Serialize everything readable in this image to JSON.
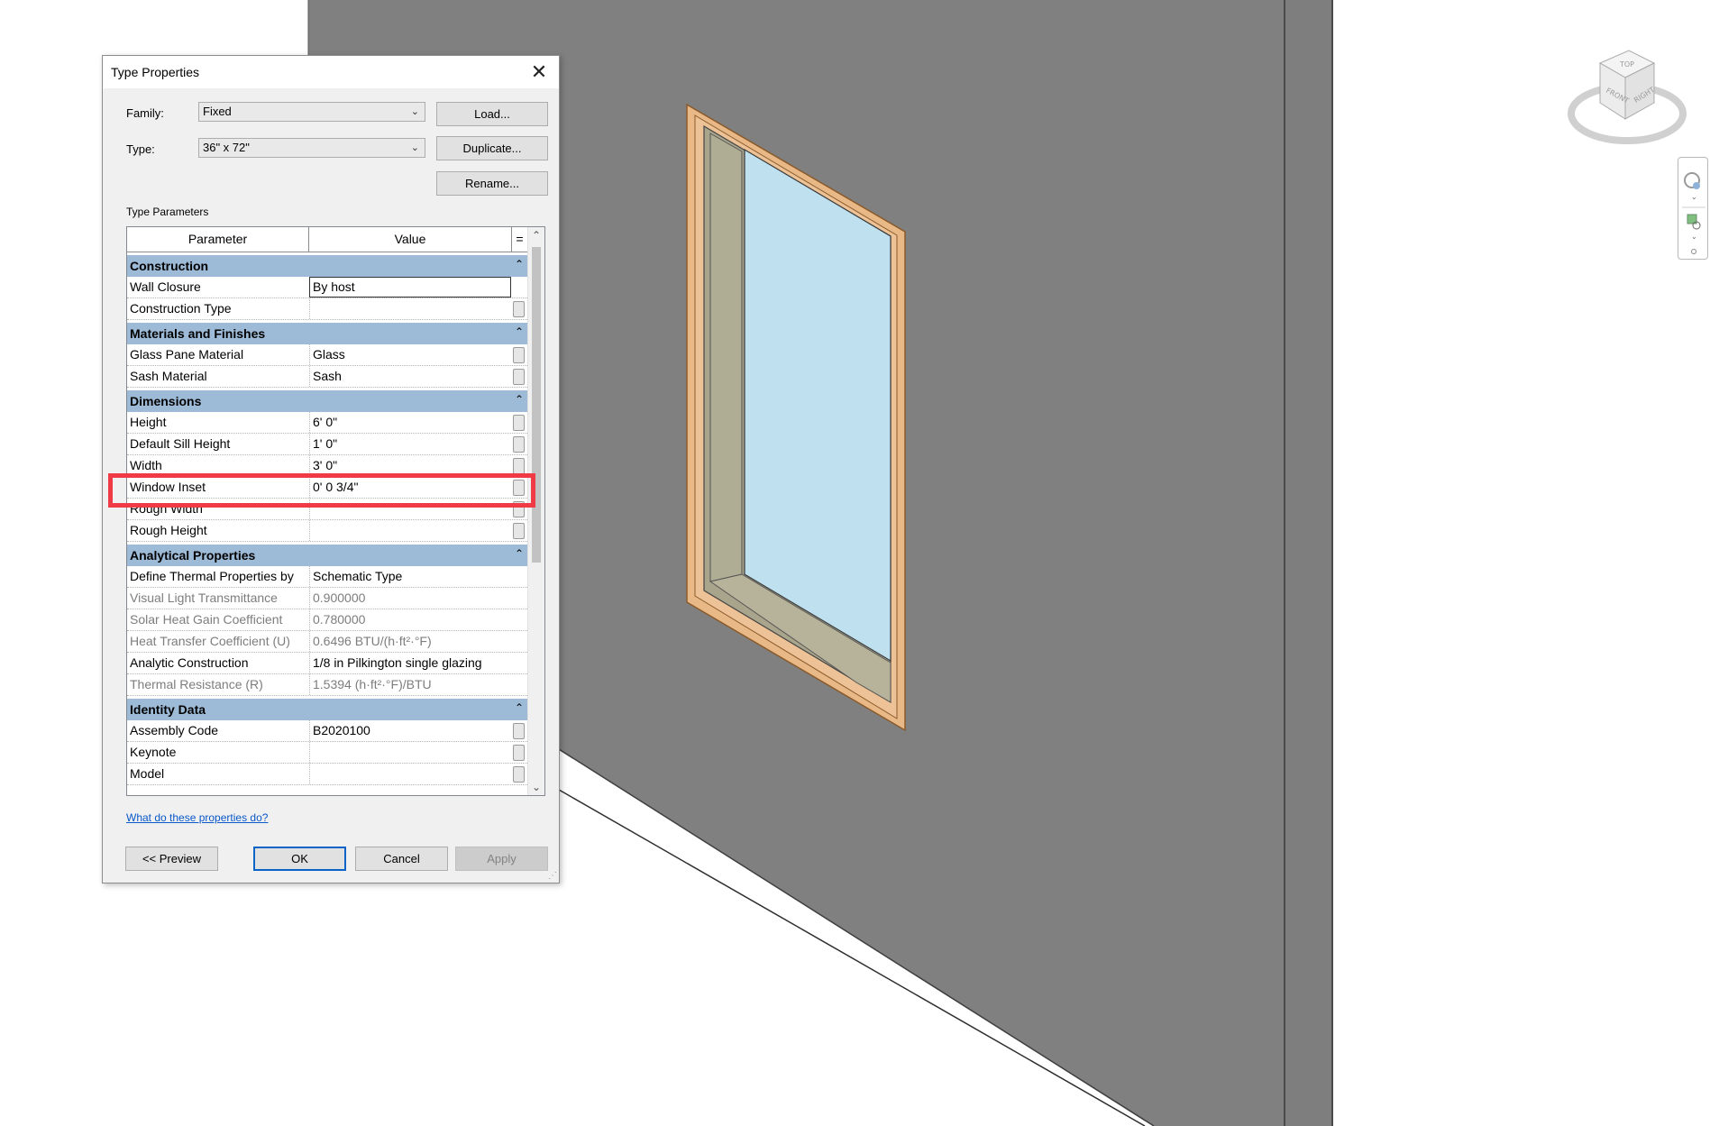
{
  "dialog": {
    "title": "Type Properties",
    "family_label": "Family:",
    "family_value": "Fixed",
    "type_label": "Type:",
    "type_value": "36\" x 72\"",
    "load_label": "Load...",
    "duplicate_label": "Duplicate...",
    "rename_label": "Rename...",
    "type_parameters_label": "Type Parameters",
    "col_parameter": "Parameter",
    "col_value": "Value",
    "col_eq": "=",
    "help_link": "What do these properties do?",
    "preview_label": "<< Preview",
    "ok_label": "OK",
    "cancel_label": "Cancel",
    "apply_label": "Apply"
  },
  "groups": [
    {
      "name": "Construction",
      "rows": [
        {
          "param": "Wall Closure",
          "value": "By host",
          "editing": true,
          "square": false
        },
        {
          "param": "Construction Type",
          "value": "",
          "square": true
        }
      ]
    },
    {
      "name": "Materials and Finishes",
      "rows": [
        {
          "param": "Glass Pane Material",
          "value": "Glass",
          "square": true
        },
        {
          "param": "Sash Material",
          "value": "Sash",
          "square": true
        }
      ]
    },
    {
      "name": "Dimensions",
      "rows": [
        {
          "param": "Height",
          "value": "6'  0\"",
          "square": true
        },
        {
          "param": "Default Sill Height",
          "value": "1'  0\"",
          "square": true
        },
        {
          "param": "Width",
          "value": "3'  0\"",
          "square": true
        },
        {
          "param": "Window Inset",
          "value": "0'  0 3/4\"",
          "square": true
        },
        {
          "param": "Rough Width",
          "value": "",
          "square": true
        },
        {
          "param": "Rough Height",
          "value": "",
          "square": true
        }
      ]
    },
    {
      "name": "Analytical Properties",
      "rows": [
        {
          "param": "Define Thermal Properties by",
          "value": "Schematic Type",
          "square": false
        },
        {
          "param": "Visual Light Transmittance",
          "value": "0.900000",
          "dim": true,
          "square": false
        },
        {
          "param": "Solar Heat Gain Coefficient",
          "value": "0.780000",
          "dim": true,
          "square": false
        },
        {
          "param": "Heat Transfer Coefficient (U)",
          "value": "0.6496 BTU/(h·ft²·°F)",
          "dim": true,
          "square": false
        },
        {
          "param": "Analytic Construction",
          "value": "1/8 in Pilkington single glazing",
          "square": false
        },
        {
          "param": "Thermal Resistance (R)",
          "value": "1.5394 (h·ft²·°F)/BTU",
          "dim": true,
          "square": false
        }
      ]
    },
    {
      "name": "Identity Data",
      "rows": [
        {
          "param": "Assembly Code",
          "value": "B2020100",
          "square": true
        },
        {
          "param": "Keynote",
          "value": "",
          "square": true
        },
        {
          "param": "Model",
          "value": "",
          "square": true
        }
      ]
    }
  ],
  "viewcube": {
    "top": "TOP",
    "front": "FRONT",
    "right": "RIGHT"
  },
  "icons": [
    "close-icon",
    "chevron-down-icon",
    "collapse-icon",
    "scroll-up-icon",
    "scroll-down-icon",
    "resize-grip-icon",
    "view-cube-icon",
    "steering-wheel-icon",
    "zoom-icon"
  ],
  "colors": {
    "wall": "#808080",
    "wall_dark": "#5a5a5a",
    "glass": "#bfe0ee",
    "frame": "#e8b886",
    "frame_edge": "#8a5a2a",
    "sash": "#a9a58c",
    "group_header": "#9dbad7",
    "highlight": "#f03a45",
    "link": "#0a58ca"
  }
}
